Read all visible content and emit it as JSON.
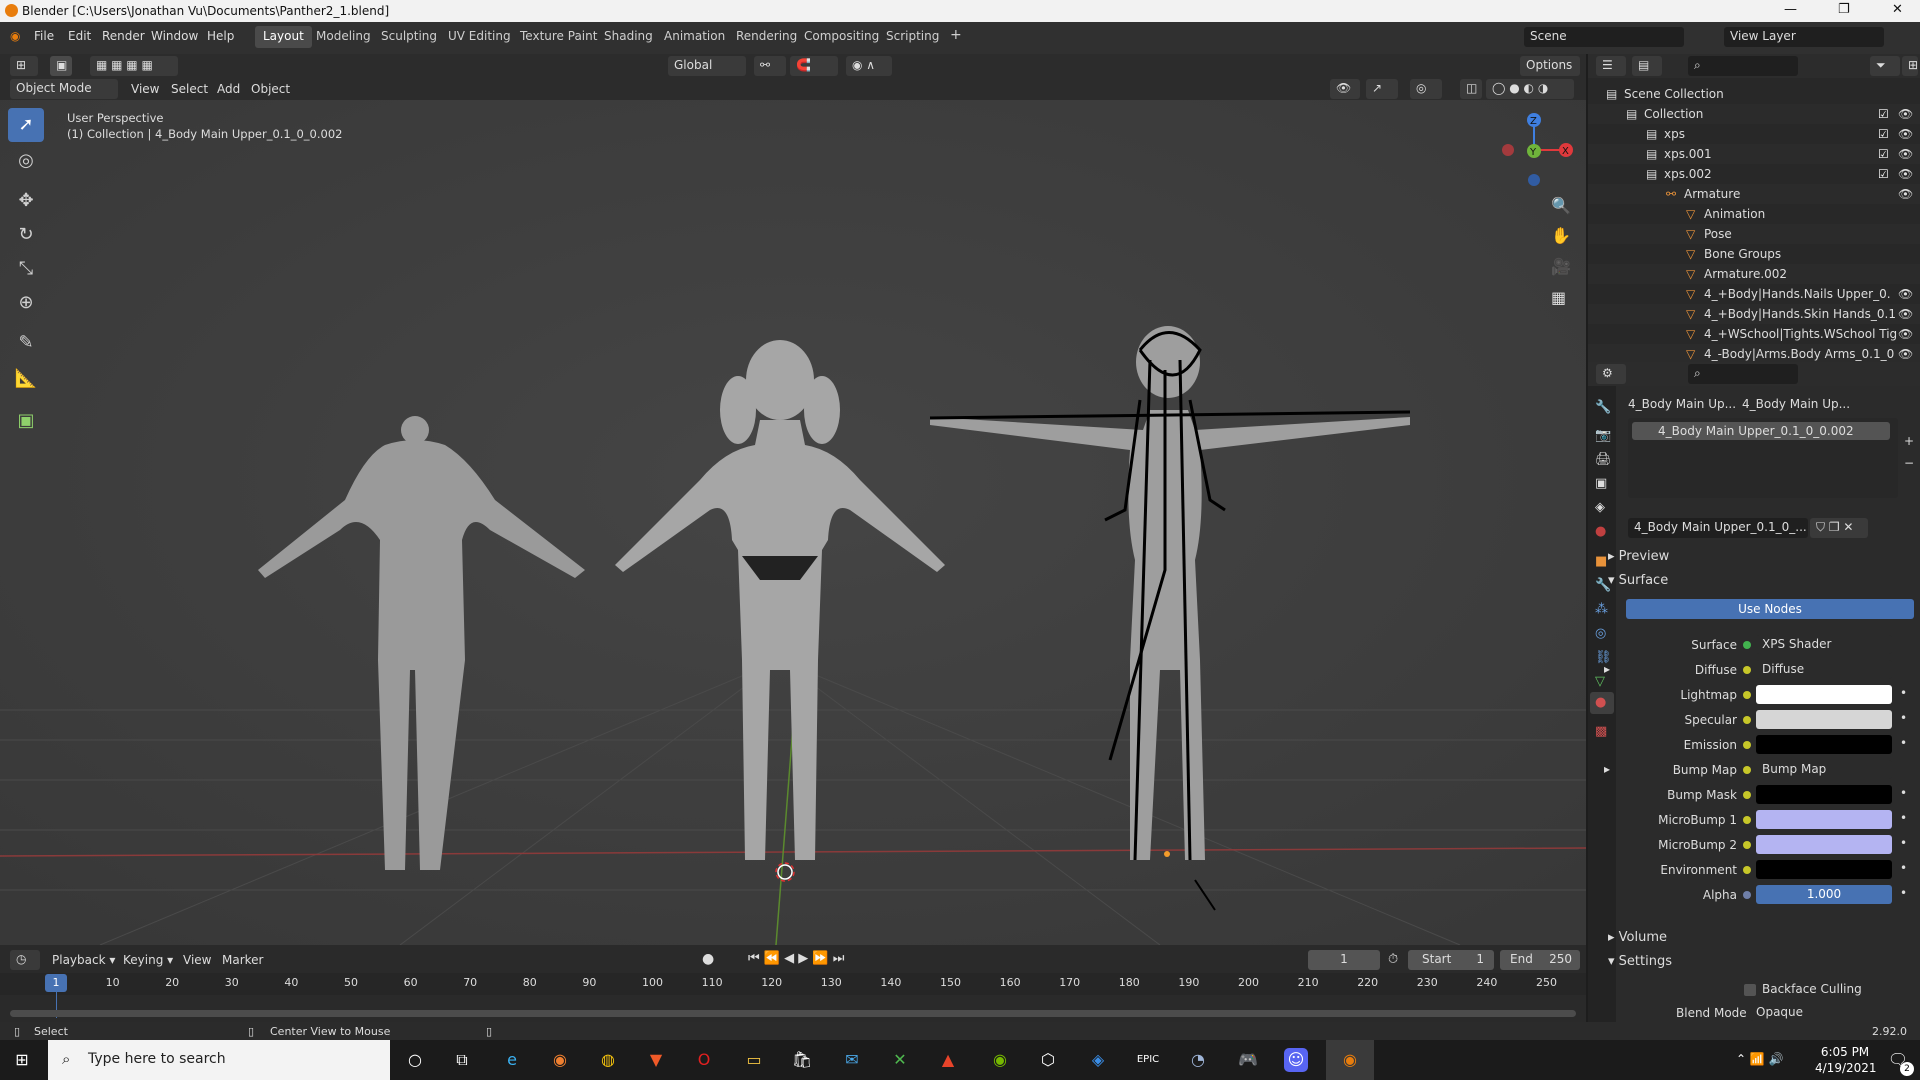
{
  "window": {
    "title": "Blender [C:\\Users\\Jonathan Vu\\Documents\\Panther2_1.blend]",
    "minimize": "—",
    "maximize": "❐",
    "close": "✕"
  },
  "menubar": {
    "items": [
      "File",
      "Edit",
      "Render",
      "Window",
      "Help"
    ],
    "workspaces": [
      "Layout",
      "Modeling",
      "Sculpting",
      "UV Editing",
      "Texture Paint",
      "Shading",
      "Animation",
      "Rendering",
      "Compositing",
      "Scripting"
    ],
    "active_workspace": "Layout",
    "add_tab": "+",
    "scene": "Scene",
    "view_layer": "View Layer"
  },
  "viewport_header": {
    "mode": "Object Mode",
    "menus": [
      "View",
      "Select",
      "Add",
      "Object"
    ],
    "orientation": "Global",
    "options": "Options"
  },
  "viewport": {
    "perspective": "User Perspective",
    "collection_info": "(1) Collection | 4_Body Main Upper_0.1_0_0.002",
    "gizmo": {
      "x": "X",
      "y": "Y",
      "z": "Z"
    }
  },
  "timeline": {
    "menus": [
      "Playback",
      "Keying",
      "View",
      "Marker"
    ],
    "current_frame": "1",
    "start_label": "Start",
    "start": "1",
    "end_label": "End",
    "end": "250",
    "ticks": [
      "10",
      "20",
      "30",
      "40",
      "50",
      "60",
      "70",
      "80",
      "90",
      "100",
      "110",
      "120",
      "130",
      "140",
      "150",
      "160",
      "170",
      "180",
      "190",
      "200",
      "210",
      "220",
      "230",
      "240",
      "250"
    ],
    "playhead": "1"
  },
  "statusbar": {
    "left": "Select",
    "middle": "Center View to Mouse",
    "version": "2.92.0"
  },
  "outliner": {
    "rows": [
      {
        "label": "Scene Collection",
        "indent": 0,
        "check": false,
        "eye": false
      },
      {
        "label": "Collection",
        "indent": 1,
        "check": true,
        "eye": true
      },
      {
        "label": "xps",
        "indent": 2,
        "check": true,
        "eye": true
      },
      {
        "label": "xps.001",
        "indent": 2,
        "check": true,
        "eye": true
      },
      {
        "label": "xps.002",
        "indent": 2,
        "check": true,
        "eye": true
      },
      {
        "label": "Armature",
        "indent": 3,
        "check": false,
        "eye": true
      },
      {
        "label": "Animation",
        "indent": 4,
        "check": false,
        "eye": false
      },
      {
        "label": "Pose",
        "indent": 4,
        "check": false,
        "eye": false
      },
      {
        "label": "Bone Groups",
        "indent": 4,
        "check": false,
        "eye": false
      },
      {
        "label": "Armature.002",
        "indent": 4,
        "check": false,
        "eye": false
      },
      {
        "label": "4_+Body|Hands.Nails Upper_0.",
        "indent": 4,
        "check": false,
        "eye": true
      },
      {
        "label": "4_+Body|Hands.Skin Hands_0.1",
        "indent": 4,
        "check": false,
        "eye": true
      },
      {
        "label": "4_+WSchool|Tights.WSchool Tig",
        "indent": 4,
        "check": false,
        "eye": true
      },
      {
        "label": "4_-Body|Arms.Body Arms_0.1_0",
        "indent": 4,
        "check": false,
        "eye": true
      }
    ]
  },
  "properties": {
    "object_name": "4_Body Main Up...",
    "material_tab_name": "4_Body Main Up...",
    "material_slot": "4_Body Main Upper_0.1_0_0.002",
    "material_field": "4_Body Main Upper_0.1_0_...",
    "sections": {
      "preview": "Preview",
      "surface": "Surface",
      "volume": "Volume",
      "settings": "Settings"
    },
    "use_nodes": "Use Nodes",
    "surface_label": "Surface",
    "surface_value": "XPS Shader",
    "inputs": [
      {
        "label": "Diffuse",
        "value": "Diffuse",
        "kind": "link",
        "color": ""
      },
      {
        "label": "Lightmap",
        "value": "",
        "kind": "color",
        "color": "#ffffff"
      },
      {
        "label": "Specular",
        "value": "",
        "kind": "color",
        "color": "#d6d6d6"
      },
      {
        "label": "Emission",
        "value": "",
        "kind": "color",
        "color": "#000000"
      },
      {
        "label": "Bump Map",
        "value": "Bump Map",
        "kind": "link",
        "color": ""
      },
      {
        "label": "Bump Mask",
        "value": "",
        "kind": "color",
        "color": "#000000"
      },
      {
        "label": "MicroBump 1",
        "value": "",
        "kind": "color",
        "color": "#b4b4f2"
      },
      {
        "label": "MicroBump 2",
        "value": "",
        "kind": "color",
        "color": "#b4b4f2"
      },
      {
        "label": "Environment",
        "value": "",
        "kind": "color",
        "color": "#000000"
      },
      {
        "label": "Alpha",
        "value": "1.000",
        "kind": "number",
        "color": "#4772b3"
      }
    ],
    "backface_culling": "Backface Culling",
    "blend_mode_label": "Blend Mode",
    "blend_mode": "Opaque"
  },
  "taskbar": {
    "search_placeholder": "Type here to search",
    "time": "6:05 PM",
    "date": "4/19/2021",
    "notification_count": "2"
  }
}
